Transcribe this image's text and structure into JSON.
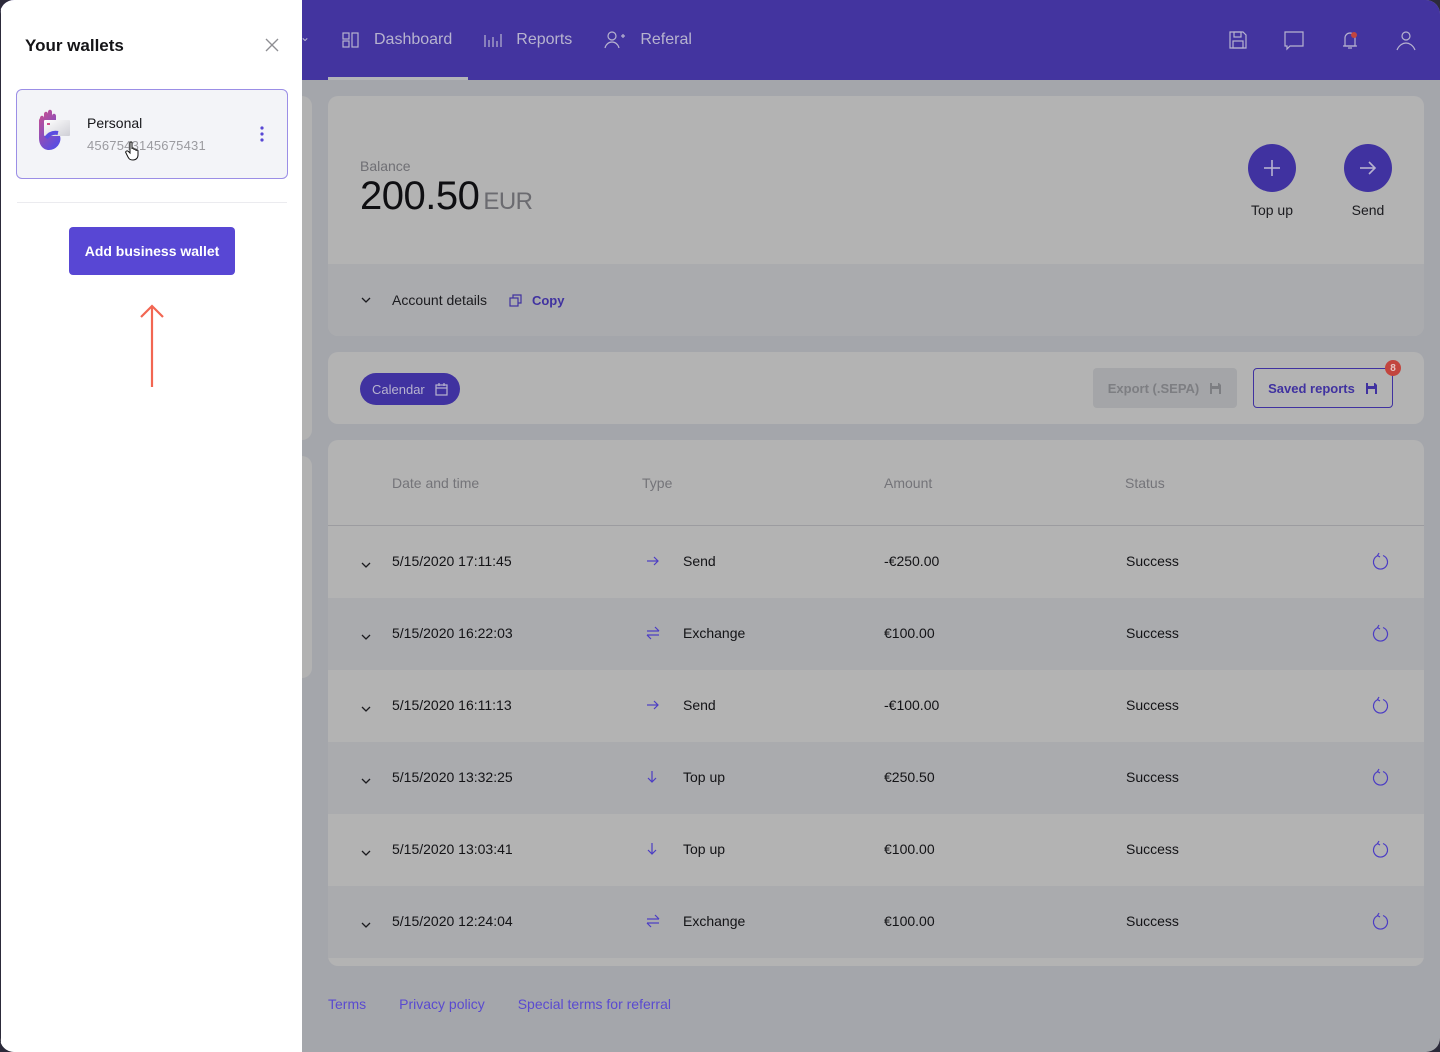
{
  "colors": {
    "brand": "#43349f",
    "accent": "#5847d4",
    "notification": "#c2453e",
    "hint_arrow": "#f26652"
  },
  "topbar": {
    "nav": [
      {
        "label": "Dashboard",
        "icon": "dashboard-icon",
        "active": true
      },
      {
        "label": "Reports",
        "icon": "reports-icon",
        "active": false
      },
      {
        "label": "Referal",
        "icon": "add-user-icon",
        "active": false
      }
    ],
    "icons": [
      "save-icon",
      "chat-icon",
      "bell-icon",
      "user-icon"
    ],
    "has_notification": true
  },
  "balance": {
    "label": "Balance",
    "amount": "200.50",
    "currency": "EUR",
    "actions": [
      {
        "label": "Top up",
        "icon": "plus-icon"
      },
      {
        "label": "Send",
        "icon": "arrow-right-icon"
      }
    ],
    "account_details_label": "Account details",
    "copy_label": "Copy"
  },
  "filters": {
    "calendar_label": "Calendar",
    "export_label": "Export (.SEPA)",
    "saved_reports_label": "Saved reports",
    "saved_reports_count": "8"
  },
  "transactions": {
    "columns": [
      "Date and time",
      "Type",
      "Amount",
      "Status"
    ],
    "rows": [
      {
        "datetime": "5/15/2020 17:11:45",
        "type": "Send",
        "type_icon": "arrow-right-icon",
        "amount": "-€250.00",
        "status": "Success"
      },
      {
        "datetime": "5/15/2020 16:22:03",
        "type": "Exchange",
        "type_icon": "exchange-icon",
        "amount": "€100.00",
        "status": "Success"
      },
      {
        "datetime": "5/15/2020 16:11:13",
        "type": "Send",
        "type_icon": "arrow-right-icon",
        "amount": "-€100.00",
        "status": "Success"
      },
      {
        "datetime": "5/15/2020 13:32:25",
        "type": "Top up",
        "type_icon": "arrow-down-icon",
        "amount": "€250.50",
        "status": "Success"
      },
      {
        "datetime": "5/15/2020 13:03:41",
        "type": "Top up",
        "type_icon": "arrow-down-icon",
        "amount": "€100.00",
        "status": "Success"
      },
      {
        "datetime": "5/15/2020 12:24:04",
        "type": "Exchange",
        "type_icon": "exchange-icon",
        "amount": "€100.00",
        "status": "Success"
      }
    ]
  },
  "footer": {
    "links": [
      "Terms",
      "Privacy policy",
      "Special terms for referral"
    ]
  },
  "drawer": {
    "title": "Your wallets",
    "wallets": [
      {
        "name": "Personal",
        "number": "4567543145675431"
      }
    ],
    "add_button_label": "Add business wallet"
  }
}
